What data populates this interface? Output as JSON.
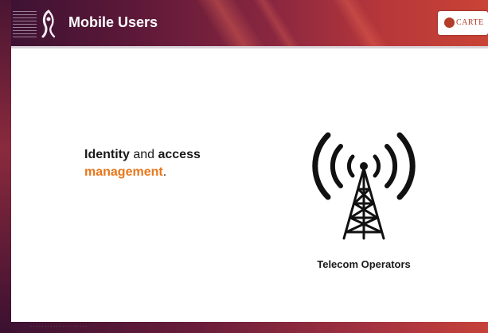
{
  "header": {
    "title": "Mobile Users",
    "logo_text": "CARTE"
  },
  "content": {
    "headline": {
      "part1": "Identity",
      "part2": " and ",
      "part3": "access",
      "part4": "management",
      "part5": "."
    },
    "tower_caption": "Telecom Operators"
  },
  "icons": [
    "government-emblem-icon",
    "logo-mark-icon",
    "telecom-tower-icon"
  ],
  "colors": {
    "header_dark": "#3e1233",
    "header_light": "#c94436",
    "accent": "#e8761a",
    "text": "#1a1a1a",
    "logo": "#b33c2a"
  }
}
